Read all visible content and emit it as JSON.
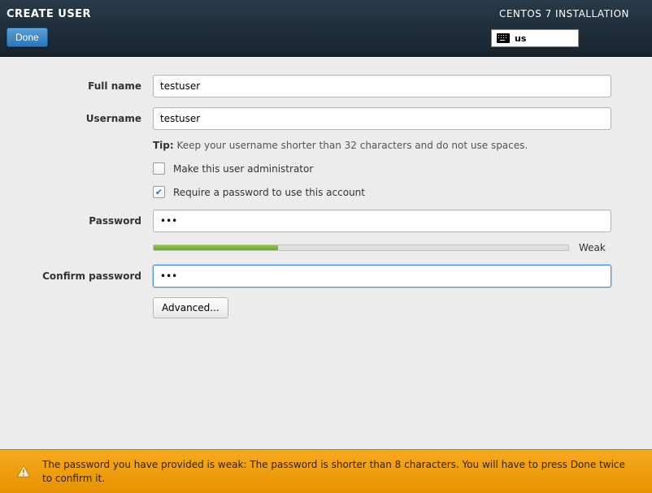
{
  "header": {
    "title": "CREATE USER",
    "done_label": "Done",
    "right_title": "CENTOS 7 INSTALLATION",
    "keyboard_layout": "us"
  },
  "form": {
    "full_name_label": "Full name",
    "full_name_value": "testuser",
    "username_label": "Username",
    "username_value": "testuser",
    "tip_prefix": "Tip:",
    "tip_text": "Keep your username shorter than 32 characters and do not use spaces.",
    "admin_checkbox_label": "Make this user administrator",
    "admin_checked": false,
    "require_password_label": "Require a password to use this account",
    "require_password_checked": true,
    "password_label": "Password",
    "password_value": "•••",
    "strength_label": "Weak",
    "strength_percent": 30,
    "confirm_label": "Confirm password",
    "confirm_value": "•••",
    "advanced_label": "Advanced..."
  },
  "warning": {
    "text": "The password you have provided is weak: The password is shorter than 8 characters. You will have to press Done twice to confirm it."
  }
}
